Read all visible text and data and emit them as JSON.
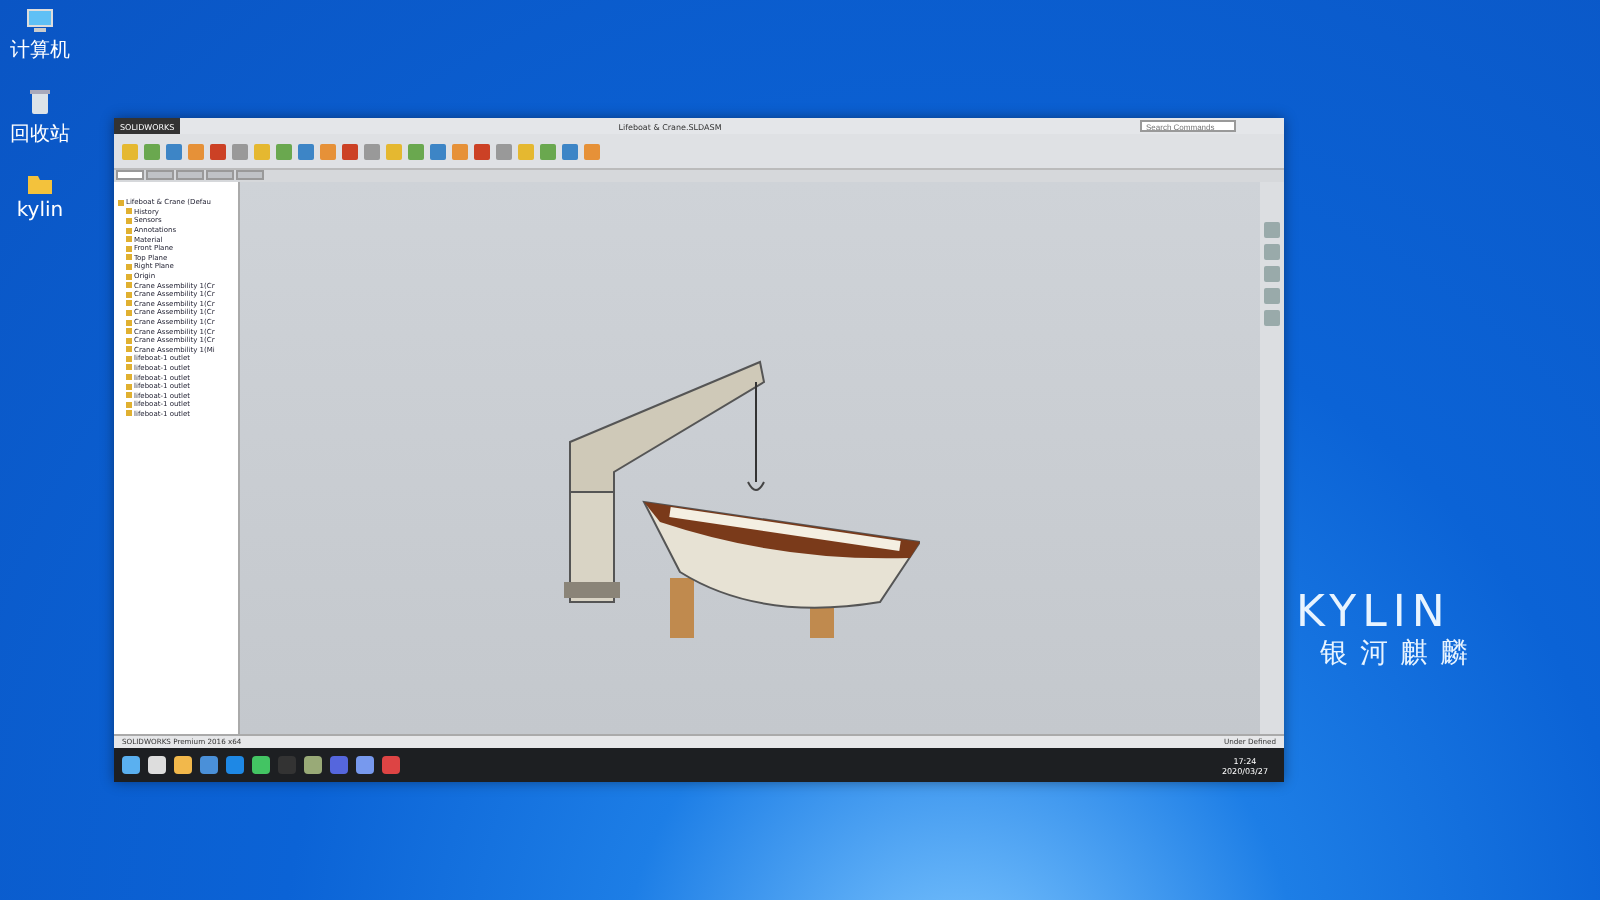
{
  "desktop_icons": [
    {
      "kind": "computer",
      "label": "计算机"
    },
    {
      "kind": "trash",
      "label": "回收站"
    },
    {
      "kind": "folder",
      "label": "kylin"
    }
  ],
  "window": {
    "app_name": "SOLIDWORKS",
    "title": "Lifeboat & Crane.SLDASM",
    "search": {
      "placeholder": "Search Commands"
    }
  },
  "ribbon_tabs": [
    {
      "selected": true
    },
    {
      "selected": false
    },
    {
      "selected": false
    },
    {
      "selected": false
    },
    {
      "selected": false
    }
  ],
  "feature_tree": {
    "items": [
      {
        "label": "Lifeboat & Crane (Defau",
        "children": [
          {
            "label": "History"
          },
          {
            "label": "Sensors"
          },
          {
            "label": "Annotations"
          },
          {
            "label": "Material"
          },
          {
            "label": "Front Plane"
          },
          {
            "label": "Top Plane"
          },
          {
            "label": "Right Plane"
          },
          {
            "label": "Origin"
          },
          {
            "label": "Crane Assembility 1(Cr"
          },
          {
            "label": "Crane Assembility 1(Cr"
          },
          {
            "label": "Crane Assembility 1(Cr"
          },
          {
            "label": "Crane Assembility 1(Cr"
          },
          {
            "label": "Crane Assembility 1(Cr"
          },
          {
            "label": "Crane Assembility 1(Cr"
          },
          {
            "label": "Crane Assembility 1(Cr"
          },
          {
            "label": "Crane Assembility 1(Mi"
          },
          {
            "label": "lifeboat-1 outlet"
          },
          {
            "label": "lifeboat-1 outlet"
          },
          {
            "label": "lifeboat-1 outlet"
          },
          {
            "label": "lifeboat-1 outlet"
          },
          {
            "label": "lifeboat-1 outlet"
          },
          {
            "label": "lifeboat-1 outlet"
          },
          {
            "label": "lifeboat-1 outlet"
          }
        ]
      }
    ]
  },
  "status_bar": {
    "left": "SOLIDWORKS Premium 2016 x64",
    "right": "Under Defined"
  },
  "taskbar": {
    "time": "17:24",
    "date": "2020/03/27"
  },
  "logo": {
    "brand": "KYLIN",
    "subtitle": "银河麒麟"
  }
}
